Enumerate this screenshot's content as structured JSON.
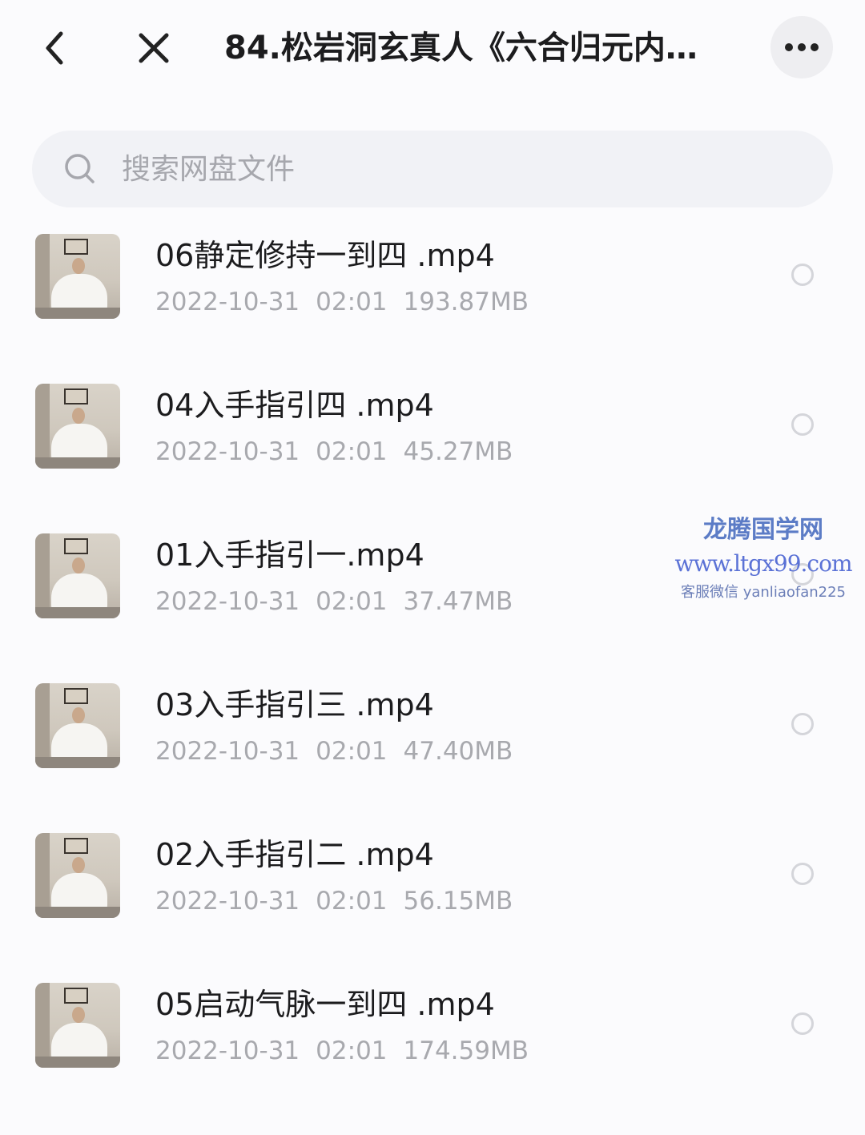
{
  "header": {
    "title": "84.松岩洞玄真人《六合归元内…",
    "back_icon": "chevron-left-icon",
    "close_icon": "close-icon",
    "more_icon": "more-horizontal-icon"
  },
  "search": {
    "placeholder": "搜索网盘文件",
    "icon": "search-icon"
  },
  "files": [
    {
      "name": "06静定修持一到四 .mp4",
      "date": "2022-10-31",
      "time": "02:01",
      "size": "193.87MB"
    },
    {
      "name": "04入手指引四 .mp4",
      "date": "2022-10-31",
      "time": "02:01",
      "size": "45.27MB"
    },
    {
      "name": "01入手指引一.mp4",
      "date": "2022-10-31",
      "time": "02:01",
      "size": "37.47MB"
    },
    {
      "name": "03入手指引三 .mp4",
      "date": "2022-10-31",
      "time": "02:01",
      "size": "47.40MB"
    },
    {
      "name": "02入手指引二 .mp4",
      "date": "2022-10-31",
      "time": "02:01",
      "size": "56.15MB"
    },
    {
      "name": "05启动气脉一到四 .mp4",
      "date": "2022-10-31",
      "time": "02:01",
      "size": "174.59MB"
    }
  ],
  "watermark": {
    "line1": "龙腾国学网",
    "line2": "www.ltgx99.com",
    "line3": "客服微信 yanliaofan225"
  },
  "colors": {
    "background": "#fbfbfd",
    "search_bg": "#f1f2f6",
    "meta_text": "#a8a9ae",
    "watermark": "#5b72d6"
  }
}
